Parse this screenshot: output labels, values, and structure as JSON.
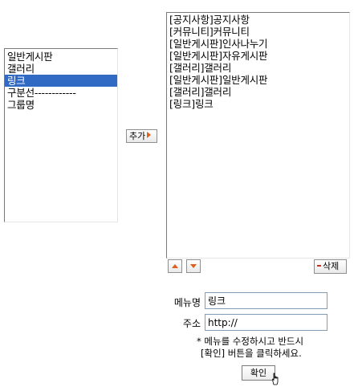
{
  "left_list": {
    "items": [
      "일반게시판",
      "갤러리",
      "링크",
      "구분선------------",
      "그룹명"
    ],
    "selected_index": 2
  },
  "right_list": {
    "items": [
      "[공지사항]공지사항",
      "[커뮤니티]커뮤니티",
      "[일반게시판]인사나누기",
      "[일반게시판]자유게시판",
      "[갤러리]갤러리",
      "[일반게시판]일반게시판",
      "[갤러리]갤러리",
      "[링크]링크"
    ]
  },
  "buttons": {
    "add_label": "추가",
    "delete_label": "삭제",
    "confirm_label": "확인"
  },
  "form": {
    "menu_name_label": "메뉴명",
    "menu_name_value": "링크",
    "address_label": "주소",
    "address_value": "http://"
  },
  "notice": {
    "line1": "* 메뉴를 수정하시고 반드시",
    "line2": "[확인] 버튼을 클릭하세요."
  },
  "colors": {
    "selection": "#316ac5",
    "arrow_accent": "#e0601b",
    "input_border": "#7f9db9"
  },
  "icons": {
    "add_arrow": "triangle-right",
    "move_up": "triangle-up",
    "move_down": "triangle-down",
    "delete": "minus",
    "pointer": "hand-cursor"
  }
}
